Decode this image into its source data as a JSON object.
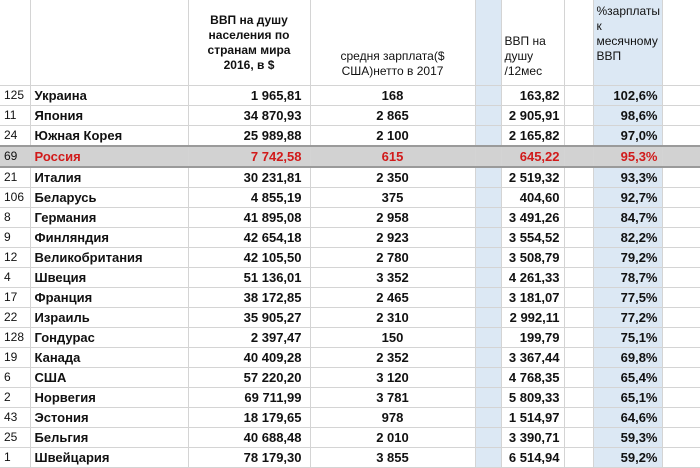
{
  "headers": {
    "gdp2016": "ВВП на душу населения по странам мира 2016, в $",
    "salary": "средня зарплата($ США)нетто в 2017",
    "gdp_month": "ВВП на душу /12мес",
    "pct": "%зарплаты к месячному ВВП"
  },
  "highlight_color": "#d11a1a",
  "rows": [
    {
      "rank": "125",
      "country": "Украина",
      "gdp": "1 965,81",
      "salary": "168",
      "gdp_month": "163,82",
      "pct": "102,6%"
    },
    {
      "rank": "11",
      "country": "Япония",
      "gdp": "34 870,93",
      "salary": "2 865",
      "gdp_month": "2 905,91",
      "pct": "98,6%"
    },
    {
      "rank": "24",
      "country": "Южная Корея",
      "gdp": "25 989,88",
      "salary": "2 100",
      "gdp_month": "2 165,82",
      "pct": "97,0%"
    },
    {
      "rank": "69",
      "country": "Россия",
      "gdp": "7 742,58",
      "salary": "615",
      "gdp_month": "645,22",
      "pct": "95,3%",
      "highlight": true
    },
    {
      "rank": "21",
      "country": "Италия",
      "gdp": "30 231,81",
      "salary": "2 350",
      "gdp_month": "2 519,32",
      "pct": "93,3%"
    },
    {
      "rank": "106",
      "country": "Беларусь",
      "gdp": "4 855,19",
      "salary": "375",
      "gdp_month": "404,60",
      "pct": "92,7%"
    },
    {
      "rank": "8",
      "country": "Германия",
      "gdp": "41 895,08",
      "salary": "2 958",
      "gdp_month": "3 491,26",
      "pct": "84,7%"
    },
    {
      "rank": "9",
      "country": "Финляндия",
      "gdp": "42 654,18",
      "salary": "2 923",
      "gdp_month": "3 554,52",
      "pct": "82,2%"
    },
    {
      "rank": "12",
      "country": "Великобритания",
      "gdp": "42 105,50",
      "salary": "2 780",
      "gdp_month": "3 508,79",
      "pct": "79,2%"
    },
    {
      "rank": "4",
      "country": "Швеция",
      "gdp": "51 136,01",
      "salary": "3 352",
      "gdp_month": "4 261,33",
      "pct": "78,7%"
    },
    {
      "rank": "17",
      "country": "Франция",
      "gdp": "38 172,85",
      "salary": "2 465",
      "gdp_month": "3 181,07",
      "pct": "77,5%"
    },
    {
      "rank": "22",
      "country": "Израиль",
      "gdp": "35 905,27",
      "salary": "2 310",
      "gdp_month": "2 992,11",
      "pct": "77,2%"
    },
    {
      "rank": "128",
      "country": "Гондурас",
      "gdp": "2 397,47",
      "salary": "150",
      "gdp_month": "199,79",
      "pct": "75,1%"
    },
    {
      "rank": "19",
      "country": "Канада",
      "gdp": "40 409,28",
      "salary": "2 352",
      "gdp_month": "3 367,44",
      "pct": "69,8%"
    },
    {
      "rank": "6",
      "country": "США",
      "gdp": "57 220,20",
      "salary": "3 120",
      "gdp_month": "4 768,35",
      "pct": "65,4%"
    },
    {
      "rank": "2",
      "country": "Норвегия",
      "gdp": "69 711,99",
      "salary": "3 781",
      "gdp_month": "5 809,33",
      "pct": "65,1%"
    },
    {
      "rank": "43",
      "country": "Эстония",
      "gdp": "18 179,65",
      "salary": "978",
      "gdp_month": "1 514,97",
      "pct": "64,6%"
    },
    {
      "rank": "25",
      "country": "Бельгия",
      "gdp": "40 688,48",
      "salary": "2 010",
      "gdp_month": "3 390,71",
      "pct": "59,3%"
    },
    {
      "rank": "1",
      "country": "Швейцария",
      "gdp": "78 179,30",
      "salary": "3 855",
      "gdp_month": "6 514,94",
      "pct": "59,2%"
    }
  ]
}
